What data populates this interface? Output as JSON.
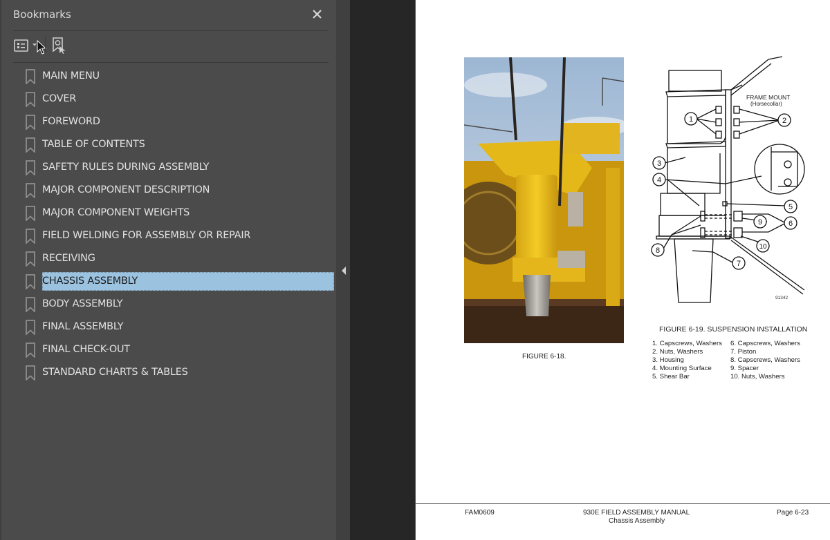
{
  "bookmarks_panel": {
    "title": "Bookmarks",
    "close_icon": "close-icon",
    "toolbar": {
      "options_icon": "bookmark-options-icon",
      "options_dropdown_icon": "chevron-down-icon",
      "find_bookmark_icon": "find-current-bookmark-icon"
    },
    "items": [
      {
        "label": "MAIN MENU",
        "selected": false
      },
      {
        "label": "COVER",
        "selected": false
      },
      {
        "label": "FOREWORD",
        "selected": false
      },
      {
        "label": "TABLE OF CONTENTS",
        "selected": false
      },
      {
        "label": "SAFETY RULES DURING ASSEMBLY",
        "selected": false
      },
      {
        "label": "MAJOR COMPONENT DESCRIPTION",
        "selected": false
      },
      {
        "label": "MAJOR COMPONENT WEIGHTS",
        "selected": false
      },
      {
        "label": "FIELD WELDING FOR ASSEMBLY OR REPAIR",
        "selected": false
      },
      {
        "label": "RECEIVING",
        "selected": false
      },
      {
        "label": "CHASSIS ASSEMBLY",
        "selected": true
      },
      {
        "label": "BODY ASSEMBLY",
        "selected": false
      },
      {
        "label": "FINAL ASSEMBLY",
        "selected": false
      },
      {
        "label": "FINAL CHECK-OUT",
        "selected": false
      },
      {
        "label": "STANDARD CHARTS & TABLES",
        "selected": false
      }
    ],
    "selected_color": "#9bc3e0"
  },
  "splitter": {
    "collapse_icon": "collapse-left-icon"
  },
  "page": {
    "figure_18": {
      "caption": "FIGURE 6-18."
    },
    "figure_19": {
      "caption": "FIGURE 6-19. SUSPENSION INSTALLATION",
      "frame_mount_label": "FRAME MOUNT",
      "frame_mount_sublabel": "(Horsecollar)",
      "drawing_number": "91342",
      "callouts": [
        "1",
        "2",
        "3",
        "4",
        "5",
        "6",
        "7",
        "8",
        "9",
        "10"
      ],
      "legend_left": [
        "1. Capscrews, Washers",
        "2. Nuts, Washers",
        "3. Housing",
        "4. Mounting Surface",
        "5. Shear Bar"
      ],
      "legend_right": [
        "6. Capscrews, Washers",
        "7. Piston",
        "8. Capscrews, Washers",
        "9. Spacer",
        "10. Nuts, Washers"
      ]
    },
    "footer": {
      "doc_id": "FAM0609",
      "manual_title": "930E FIELD ASSEMBLY MANUAL",
      "section": "Chassis Assembly",
      "page_number": "Page 6-23"
    }
  }
}
